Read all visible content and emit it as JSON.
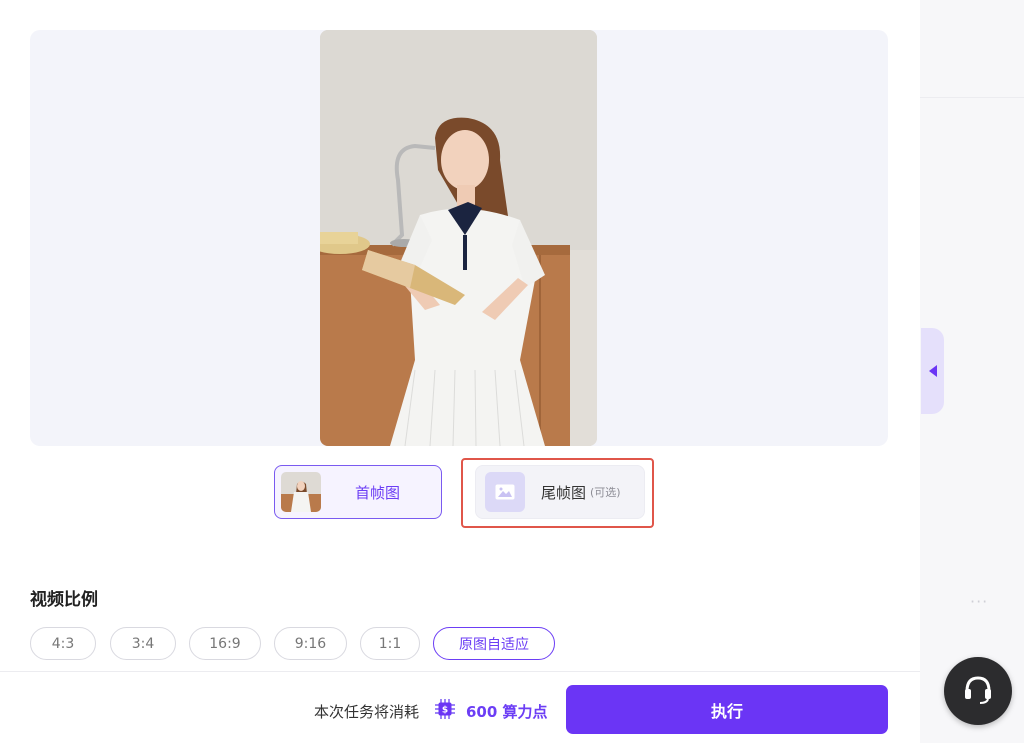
{
  "preview": {
    "first_frame_label": "首帧图",
    "last_frame_label": "尾帧图",
    "last_frame_sub": "(可选)"
  },
  "ratio_section": {
    "title": "视频比例",
    "options": [
      "4:3",
      "3:4",
      "16:9",
      "9:16",
      "1:1",
      "原图自适应"
    ],
    "selected": "原图自适应"
  },
  "footer": {
    "cost_text": "本次任务将消耗",
    "cost_value": "600 算力点",
    "run_label": "执行"
  },
  "side": {
    "more_label": "···"
  },
  "colors": {
    "accent": "#6b35f5",
    "highlight_border": "#e0564a",
    "preview_bg": "#f3f4fa"
  },
  "icons": {
    "cost": "chip-icon",
    "image_placeholder": "image-icon",
    "collapse": "caret-left-icon",
    "support": "headset-icon"
  }
}
